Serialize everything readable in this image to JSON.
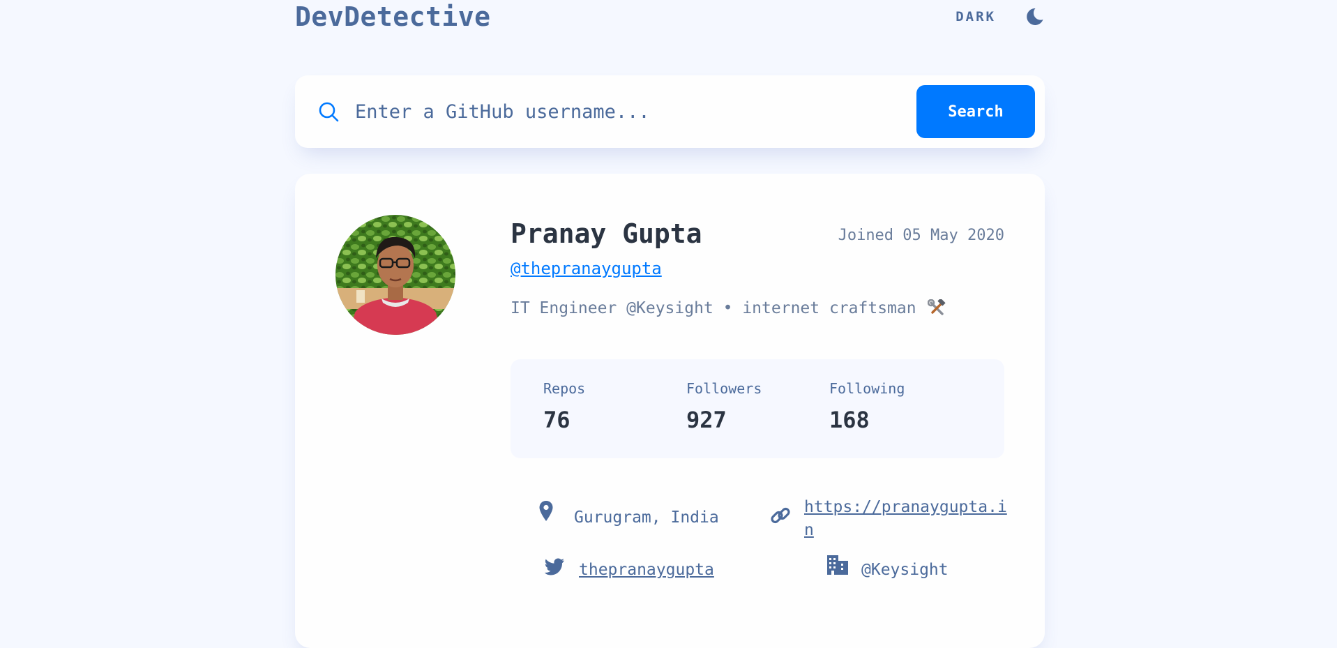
{
  "header": {
    "brand": "DevDetective",
    "theme_label": "DARK"
  },
  "search": {
    "placeholder": "Enter a GitHub username...",
    "button_label": "Search"
  },
  "profile": {
    "name": "Pranay Gupta",
    "joined": "Joined 05 May 2020",
    "login": "@thepranaygupta",
    "bio": "IT Engineer @Keysight • internet craftsman",
    "bio_emoji_icon": "hammer-and-wrench-icon",
    "stats": {
      "repos_label": "Repos",
      "repos_value": "76",
      "followers_label": "Followers",
      "followers_value": "927",
      "following_label": "Following",
      "following_value": "168"
    },
    "info": {
      "location": "Gurugram, India",
      "website_line1": "https://pranaygupta.i",
      "website_line2": "n",
      "twitter": "thepranaygupta",
      "company": "@Keysight"
    }
  },
  "colors": {
    "accent": "#0079ff",
    "text_muted": "#4b6a9b",
    "text_dark": "#2b3442",
    "background": "#f5f8ff",
    "card": "#fefefe"
  }
}
